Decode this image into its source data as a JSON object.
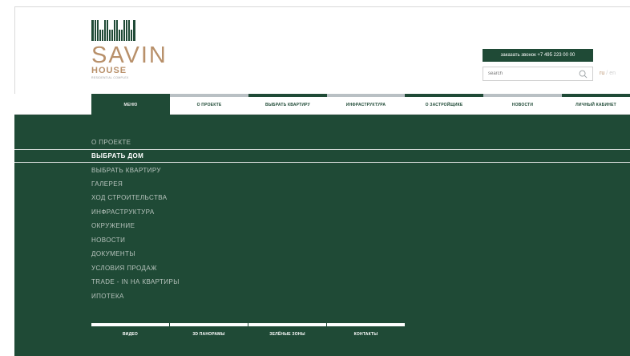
{
  "header": {
    "brand_name": "SAVIN",
    "brand_sub": "HOUSE",
    "brand_tag": "RESIDENTIAL COMPLEX",
    "call_label": "заказать звонок  +7 495 223 00 00",
    "search_placeholder": "search",
    "lang_ru": "ru",
    "lang_sep": "/",
    "lang_en": "en"
  },
  "nav": {
    "tabs": [
      {
        "label": "МЕНЮ"
      },
      {
        "label": "О ПРОЕКТЕ"
      },
      {
        "label": "ВЫБРАТЬ КВАРТИРУ"
      },
      {
        "label": "ИНФРАСТРУКТУРА"
      },
      {
        "label": "О ЗАСТРОЙЩИКЕ"
      },
      {
        "label": "НОВОСТИ"
      },
      {
        "label": "ЛИЧНЫЙ КАБИНЕТ"
      }
    ]
  },
  "menu": {
    "items": [
      {
        "label": "О ПРОЕКТЕ"
      },
      {
        "label": "ВЫБРАТЬ ДОМ"
      },
      {
        "label": "ВЫБРАТЬ КВАРТИРУ"
      },
      {
        "label": "ГАЛЕРЕЯ"
      },
      {
        "label": "ХОД СТРОИТЕЛЬСТВА"
      },
      {
        "label": "ИНФРАСТРУКТУРА"
      },
      {
        "label": "ОКРУЖЕНИЕ"
      },
      {
        "label": "НОВОСТИ"
      },
      {
        "label": "ДОКУМЕНТЫ"
      },
      {
        "label": "УСЛОВИЯ ПРОДАЖ"
      },
      {
        "label": "TRADE - IN НА КВАРТИРЫ"
      },
      {
        "label": "ИПОТЕКА"
      }
    ],
    "active_index": 1
  },
  "bottom_tabs": [
    {
      "label": "ВИДЕО"
    },
    {
      "label": "3D ПАНОРАМЫ"
    },
    {
      "label": "ЗЕЛЁНЫЕ ЗОНЫ"
    },
    {
      "label": "КОНТАКТЫ"
    }
  ],
  "colors": {
    "brand_green": "#1f4a36",
    "accent_gold": "#b8906a",
    "tab_bar_gray": "#b9c0c4"
  }
}
